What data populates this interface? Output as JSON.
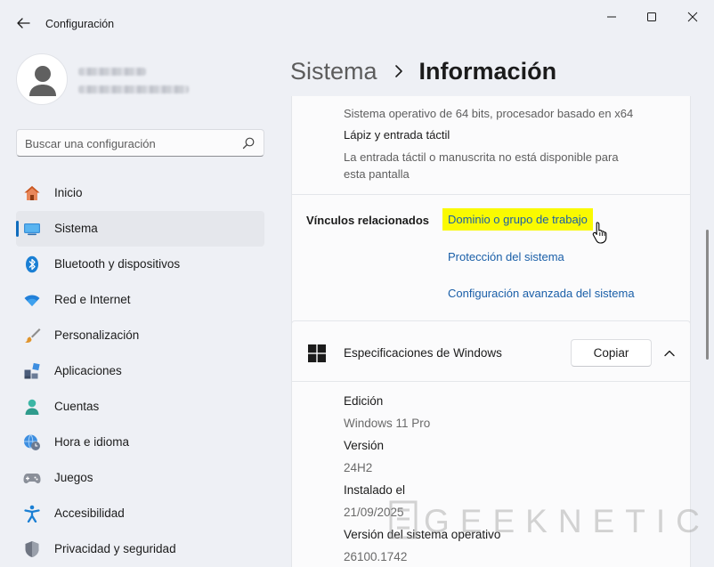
{
  "window": {
    "title": "Configuración"
  },
  "sidebar": {
    "search": {
      "placeholder": "Buscar una configuración"
    },
    "items": [
      {
        "label": "Inicio",
        "icon": "home-icon",
        "active": false
      },
      {
        "label": "Sistema",
        "icon": "system-monitor-icon",
        "active": true
      },
      {
        "label": "Bluetooth y dispositivos",
        "icon": "bluetooth-icon",
        "active": false
      },
      {
        "label": "Red e Internet",
        "icon": "wifi-icon",
        "active": false
      },
      {
        "label": "Personalización",
        "icon": "paintbrush-icon",
        "active": false
      },
      {
        "label": "Aplicaciones",
        "icon": "apps-icon",
        "active": false
      },
      {
        "label": "Cuentas",
        "icon": "account-icon",
        "active": false
      },
      {
        "label": "Hora e idioma",
        "icon": "globe-clock-icon",
        "active": false
      },
      {
        "label": "Juegos",
        "icon": "gamepad-icon",
        "active": false
      },
      {
        "label": "Accesibilidad",
        "icon": "accessibility-icon",
        "active": false
      },
      {
        "label": "Privacidad y seguridad",
        "icon": "shield-icon",
        "active": false
      }
    ]
  },
  "breadcrumb": {
    "parent": "Sistema",
    "current": "Información"
  },
  "device_specs": {
    "system_type_value": "Sistema operativo de 64 bits, procesador basado en x64",
    "pen_label": "Lápiz y entrada táctil",
    "pen_value_line1": "La entrada táctil o manuscrita no está disponible para",
    "pen_value_line2": "esta pantalla"
  },
  "related_links": {
    "title": "Vínculos relacionados",
    "links": [
      "Dominio o grupo de trabajo",
      "Protección del sistema",
      "Configuración avanzada del sistema"
    ]
  },
  "windows_specs": {
    "title": "Especificaciones de Windows",
    "copy_label": "Copiar",
    "rows": [
      {
        "label": "Edición",
        "value": "Windows 11 Pro"
      },
      {
        "label": "Versión",
        "value": "24H2"
      },
      {
        "label": "Instalado el",
        "value": "21/09/2025"
      },
      {
        "label": "Versión del sistema operativo",
        "value": "26100.1742"
      }
    ]
  },
  "watermark": {
    "text": "GEEKNETIC"
  },
  "colors": {
    "accent": "#0f6cbd",
    "link": "#1a5fa8",
    "highlight": "#fafa00",
    "background": "#eef0f5",
    "card": "#fbfbfc"
  }
}
